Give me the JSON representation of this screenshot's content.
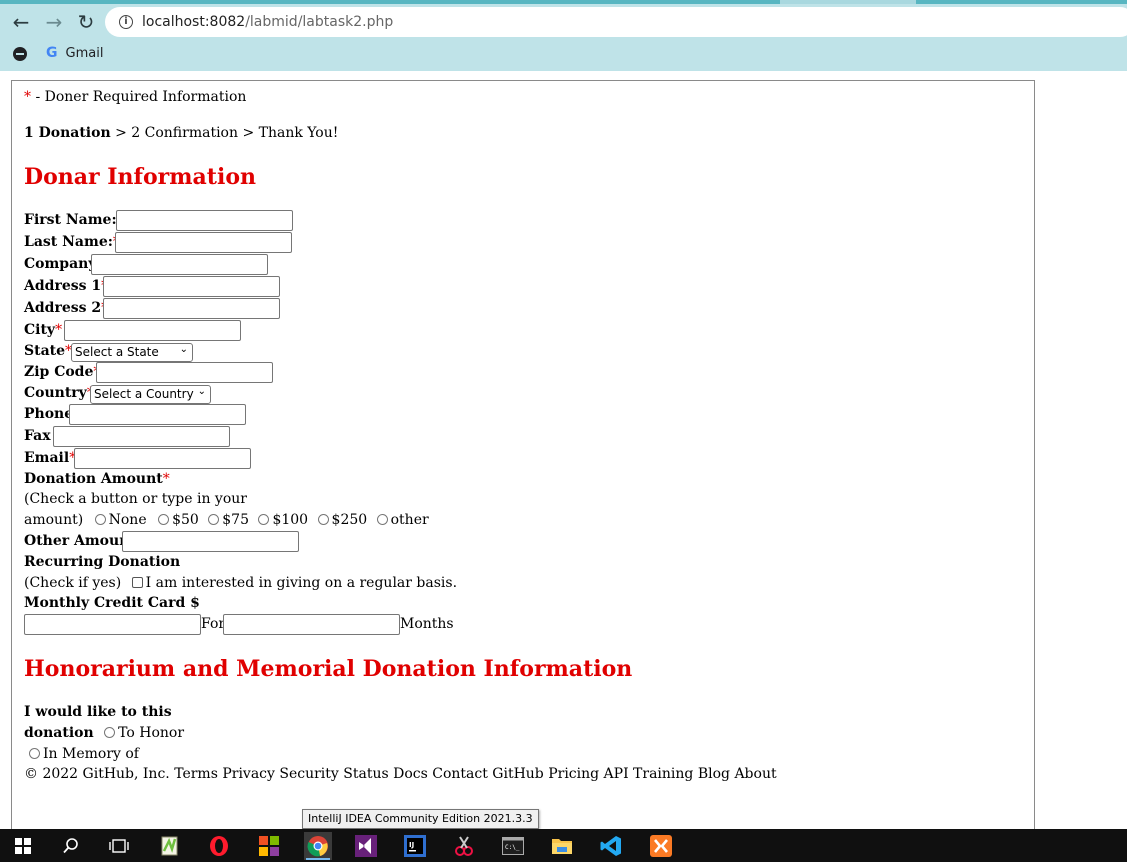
{
  "browser": {
    "url_host": "localhost:8082",
    "url_path": "/labmid/labtask2.php",
    "bookmarks": [
      {
        "label": "Gmail",
        "icon": "google-g-icon"
      }
    ],
    "bookmark_g": "G"
  },
  "page": {
    "required_note_star": "*",
    "required_note": " - Doner Required Information",
    "steps": {
      "current": "1 Donation",
      "rest": " > 2 Confirmation > Thank You!"
    },
    "donor_heading": "Donar Information",
    "fields": {
      "first_name": "First Name:",
      "last_name": "Last Name:",
      "company": "Company",
      "address1": "Address 1",
      "address2": "Address 2",
      "city": "City",
      "state": "State",
      "state_select": "Select a State",
      "zip": "Zip Code",
      "country": "Country",
      "country_select": "Select a Country",
      "phone": "Phone",
      "fax": "Fax",
      "email": "Email"
    },
    "star": "*",
    "donation_amount": {
      "label": "Donation Amount",
      "hint1": "(Check a button or type in your",
      "hint2": "amount)",
      "options": [
        "None",
        "$50",
        "$75",
        "$100",
        "$250",
        "other"
      ]
    },
    "other_amount": "Other Amount",
    "recurring": {
      "label": "Recurring Donation",
      "hint": "(Check if yes)",
      "checkbox_label": "I am interested in giving on a regular basis."
    },
    "monthly": {
      "label": "Monthly Credit Card $",
      "for": "For",
      "months": "Months"
    },
    "honor_heading": "Honorarium and Memorial Donation Information",
    "honor": {
      "label1": "I would like to this",
      "label2": "donation",
      "option1": "To Honor",
      "option2": "In Memory of"
    },
    "footer": "© 2022 GitHub, Inc. Terms Privacy Security Status Docs Contact GitHub Pricing API Training Blog About"
  },
  "tooltip": "IntelliJ IDEA Community Edition 2021.3.3",
  "taskbar": {
    "apps": [
      "start-button",
      "search-icon",
      "task-view-icon",
      "notepad-plus-plus-icon",
      "opera-icon",
      "paint-icon",
      "chrome-icon",
      "visual-studio-icon",
      "intellij-icon",
      "snipping-tool-icon",
      "terminal-icon",
      "file-explorer-icon",
      "vscode-icon",
      "xampp-icon"
    ],
    "accent": "#76b9ed"
  },
  "colors": {
    "required": "#e00000",
    "heading": "#e00000",
    "toolbar": "#bfe3e8"
  }
}
